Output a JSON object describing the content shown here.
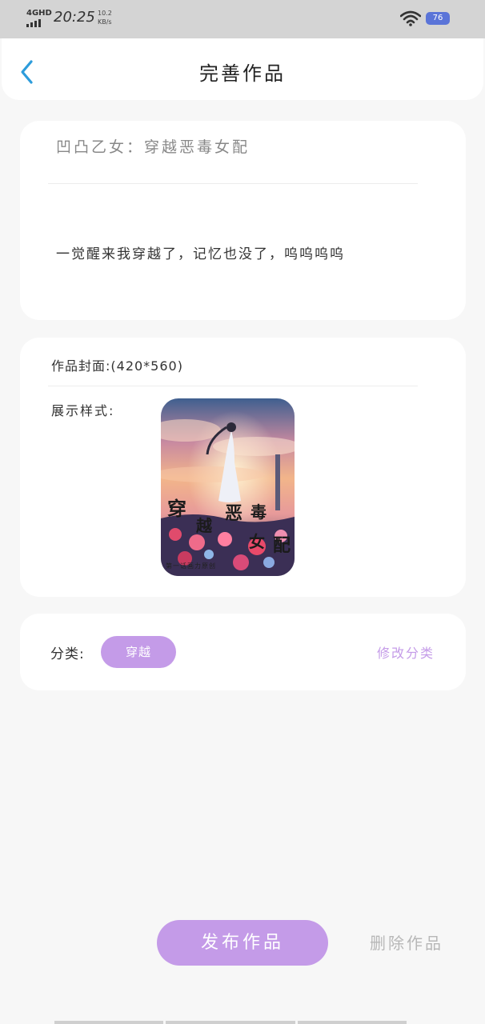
{
  "status_bar": {
    "network": "4GHD",
    "time": "20:25",
    "speed_value": "10.2",
    "speed_unit": "KB/s",
    "battery": "76",
    "battery_color": "#5a74d8"
  },
  "header": {
    "title": "完善作品",
    "back_icon": "chevron-left-icon",
    "accent_color": "#2d9cdb"
  },
  "work": {
    "title": "凹凸乙女：穿越恶毒女配",
    "intro": "一觉醒来我穿越了，记忆也没了，呜呜呜呜"
  },
  "cover": {
    "label": "作品封面:(420*560)",
    "display_label": "展示样式:",
    "image_text": {
      "line1": "穿",
      "line2": "越",
      "line3": "恶",
      "line4": "毒",
      "line5": "女",
      "line6": "配",
      "publisher": "第一话画力原创"
    }
  },
  "category": {
    "label": "分类:",
    "selected": "穿越",
    "edit_label": "修改分类",
    "accent_color": "#c49be8"
  },
  "actions": {
    "publish_label": "发布作品",
    "delete_label": "删除作品"
  }
}
